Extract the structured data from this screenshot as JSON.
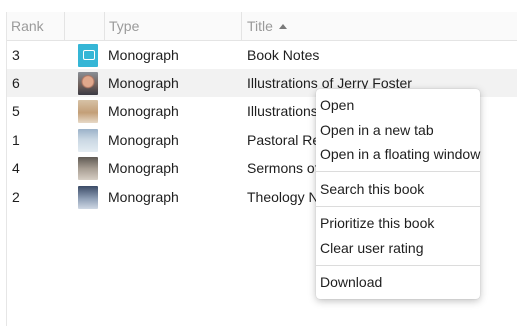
{
  "columns": [
    {
      "label": "Rank"
    },
    {
      "label": ""
    },
    {
      "label": "Type"
    },
    {
      "label": "Title",
      "sort": "ascending"
    }
  ],
  "rows": [
    {
      "rank": "3",
      "thumb": "book-notes-cover",
      "type": "Monograph",
      "title": "Book Notes"
    },
    {
      "rank": "6",
      "thumb": "portrait-cover",
      "type": "Monograph",
      "title": "Illustrations of Jerry Foster"
    },
    {
      "rank": "5",
      "thumb": "illustrations-cover",
      "type": "Monograph",
      "title": "Illustrations and Quotes"
    },
    {
      "rank": "1",
      "thumb": "pastoral-cover",
      "type": "Monograph",
      "title": "Pastoral Reflections"
    },
    {
      "rank": "4",
      "thumb": "sermons-cover",
      "type": "Monograph",
      "title": "Sermons of Jerry Foster"
    },
    {
      "rank": "2",
      "thumb": "theology-cover",
      "type": "Monograph",
      "title": "Theology Notebook"
    }
  ],
  "context_menu": {
    "group1": [
      "Open",
      "Open in a new tab",
      "Open in a floating window"
    ],
    "group2": [
      "Search this book"
    ],
    "group3": [
      "Prioritize this book",
      "Clear user rating"
    ],
    "group4": [
      "Download"
    ]
  }
}
